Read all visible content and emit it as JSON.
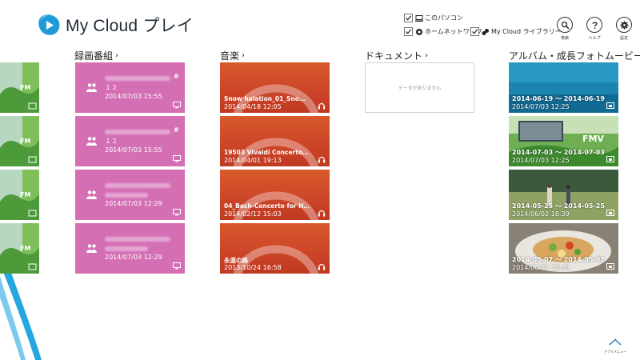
{
  "app": {
    "title": "My Cloud プレイ",
    "brand_color": "#1e9ad6"
  },
  "filters": [
    {
      "label": "このパソコン",
      "checked": true,
      "icon": "pc-icon"
    },
    {
      "label": "ホームネットワーク",
      "checked": true,
      "icon": "home-network-icon"
    },
    {
      "label": "My Cloud ライブラリー",
      "checked": true,
      "icon": "library-icon"
    }
  ],
  "top_buttons": [
    {
      "label": "検索",
      "icon": "search-icon"
    },
    {
      "label": "ヘルプ",
      "icon": "help-icon"
    },
    {
      "label": "設定",
      "icon": "gear-icon"
    }
  ],
  "sections": {
    "recordings": {
      "heading": "録画番組",
      "tile_color": "#d46fb4",
      "items": [
        {
          "mark": "#",
          "number": "１２",
          "date": "2014/07/03 15:55"
        },
        {
          "mark": "#",
          "number": "１２",
          "date": "2014/07/03 15:55"
        },
        {
          "mark": "",
          "number": "",
          "date": "2014/07/03 12:29"
        },
        {
          "mark": "",
          "number": "",
          "date": "2014/07/03 12:29"
        }
      ]
    },
    "music": {
      "heading": "音楽",
      "tile_color": "#d0492a",
      "items": [
        {
          "title": "Snow halation_01_Snow…",
          "date": "2014/04/18 12:05"
        },
        {
          "title": "19503 Vivaldi Concerto i…",
          "date": "2014/04/01 19:13"
        },
        {
          "title": "04_Bach-Concerto for Ha…",
          "date": "2014/02/12 15:03"
        },
        {
          "title": "永遠の路",
          "date": "2013/10/24 16:58"
        }
      ]
    },
    "documents": {
      "heading": "ドキュメント",
      "empty_text": "データがありません"
    },
    "albums": {
      "heading": "アルバム・成長フォトムービー",
      "items": [
        {
          "range": "2014-06-19 ～ 2014-06-19",
          "date": "2014/07/03 12:25"
        },
        {
          "range": "2014-07-03 ～ 2014-07-03",
          "date": "2014/07/03 12:25"
        },
        {
          "range": "2014-05-25 ～ 2014-05-25",
          "date": "2014/06/02 18:39"
        },
        {
          "range": "2014-05-07 ～ 2014-05-07",
          "date": "2014/06/02 18:39"
        }
      ]
    }
  },
  "app_menu": {
    "label": "アプリメニュー"
  }
}
